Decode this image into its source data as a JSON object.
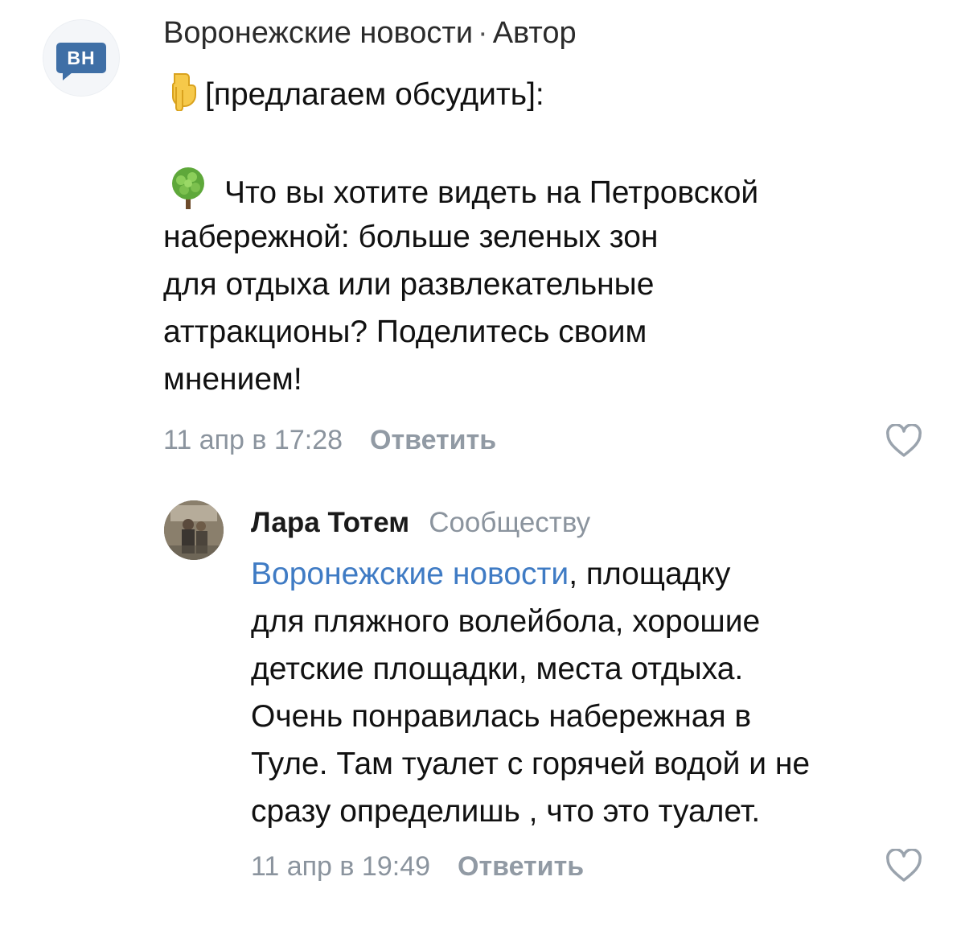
{
  "comments": [
    {
      "avatar_text": "ВН",
      "author": "Воронежские новости",
      "separator": "·",
      "role": "Автор",
      "lines": [
        "[предлагаем обсудить]:",
        "",
        "Что вы хотите видеть на Петровской",
        "набережной: больше зеленых зон",
        "для отдыха или развлекательные",
        "аттракционы? Поделитесь своим",
        "мнением!"
      ],
      "emoji_1": "backhand-index-pointing-down-icon",
      "emoji_2": "tree-icon",
      "time": "11 апр в 17:28",
      "reply_label": "Ответить",
      "like_icon": "heart-outline-icon"
    },
    {
      "author": "Лара Тотем",
      "recipient": "Сообществу",
      "mention": "Воронежские новости",
      "first_line_rest": ", площадку",
      "lines": [
        "для пляжного волейбола, хорошие",
        "детские площадки, места отдыха.",
        "Очень понравилась набережная в",
        "Туле. Там туалет с горячей водой и не",
        "сразу определишь , что это туалет."
      ],
      "time": "11 апр в 19:49",
      "reply_label": "Ответить",
      "like_icon": "heart-outline-icon"
    }
  ],
  "colors": {
    "brand": "#3f6fa6",
    "mention": "#3f7bc4",
    "meta": "#8b949e"
  }
}
